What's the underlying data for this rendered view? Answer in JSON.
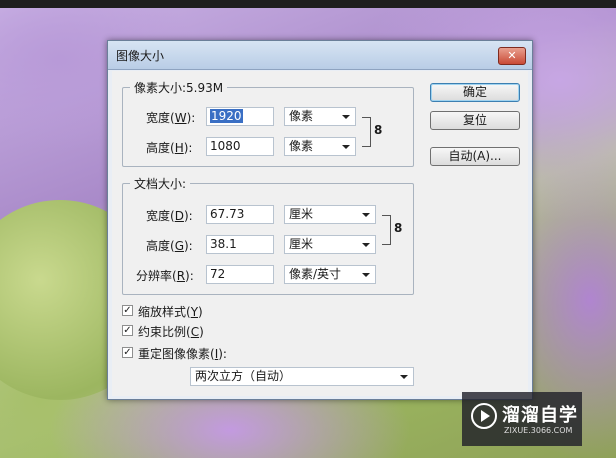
{
  "dialog": {
    "title": "图像大小",
    "close_icon": "close-icon",
    "close_symbol": "✕"
  },
  "pixel_dimensions": {
    "legend": "像素大小:5.93M",
    "width_label": "宽度(",
    "width_key": "W",
    "width_close": "):",
    "width_value": "1920",
    "width_unit": "像素",
    "height_label": "高度(",
    "height_key": "H",
    "height_close": "):",
    "height_value": "1080",
    "height_unit": "像素",
    "link_icon": "chain-link-icon",
    "link_symbol": "8"
  },
  "document_size": {
    "legend": "文档大小:",
    "width_label": "宽度(",
    "width_key": "D",
    "width_close": "):",
    "width_value": "67.73",
    "width_unit": "厘米",
    "height_label": "高度(",
    "height_key": "G",
    "height_close": "):",
    "height_value": "38.1",
    "height_unit": "厘米",
    "resolution_label": "分辨率(",
    "resolution_key": "R",
    "resolution_close": "):",
    "resolution_value": "72",
    "resolution_unit": "像素/英寸",
    "link_icon": "chain-link-icon",
    "link_symbol": "8"
  },
  "buttons": {
    "ok": "确定",
    "reset": "复位",
    "auto": "自动(A)..."
  },
  "options": {
    "scale_styles": {
      "label": "缩放样式(",
      "key": "Y",
      "close": ")",
      "checked": true
    },
    "constrain": {
      "label": "约束比例(",
      "key": "C",
      "close": ")",
      "checked": true
    },
    "resample": {
      "label": "重定图像像素(",
      "key": "I",
      "close": "):",
      "checked": true
    },
    "check_mark": "✓",
    "resample_method": "两次立方（自动）"
  },
  "watermark": {
    "name": "溜溜自学",
    "url": "ZIXUE.3066.COM",
    "icon": "play-icon"
  }
}
